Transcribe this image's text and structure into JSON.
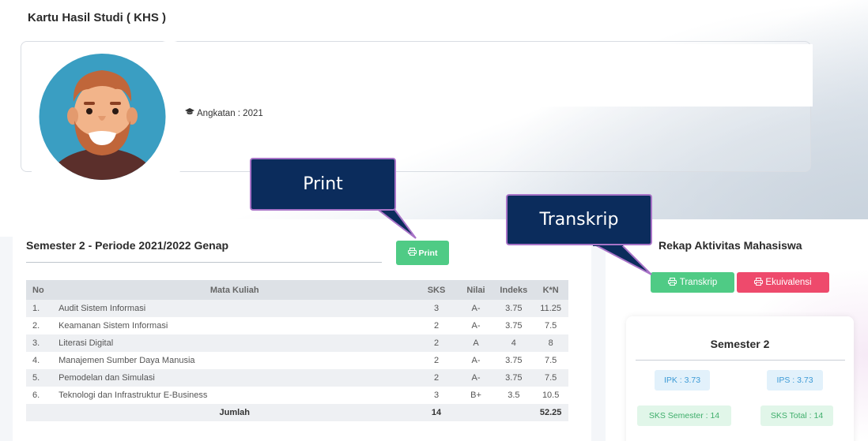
{
  "page": {
    "title": "Kartu Hasil Studi ( KHS )"
  },
  "profile": {
    "angkatan_label": "Angkatan : 2021"
  },
  "semester": {
    "title": "Semester 2 - Periode 2021/2022 Genap",
    "print_label": "Print"
  },
  "table": {
    "headers": {
      "no": "No",
      "mata_kuliah": "Mata Kuliah",
      "sks": "SKS",
      "nilai": "Nilai",
      "indeks": "Indeks",
      "kn": "K*N"
    },
    "rows": [
      {
        "no": "1.",
        "mk": "Audit Sistem Informasi",
        "sks": "3",
        "nilai": "A-",
        "indeks": "3.75",
        "kn": "11.25"
      },
      {
        "no": "2.",
        "mk": "Keamanan Sistem Informasi",
        "sks": "2",
        "nilai": "A-",
        "indeks": "3.75",
        "kn": "7.5"
      },
      {
        "no": "3.",
        "mk": "Literasi Digital",
        "sks": "2",
        "nilai": "A",
        "indeks": "4",
        "kn": "8"
      },
      {
        "no": "4.",
        "mk": "Manajemen Sumber Daya Manusia",
        "sks": "2",
        "nilai": "A-",
        "indeks": "3.75",
        "kn": "7.5"
      },
      {
        "no": "5.",
        "mk": "Pemodelan dan Simulasi",
        "sks": "2",
        "nilai": "A-",
        "indeks": "3.75",
        "kn": "7.5"
      },
      {
        "no": "6.",
        "mk": "Teknologi dan Infrastruktur E-Business",
        "sks": "3",
        "nilai": "B+",
        "indeks": "3.5",
        "kn": "10.5"
      }
    ],
    "total": {
      "label": "Jumlah",
      "sks": "14",
      "kn": "52.25"
    }
  },
  "rekap": {
    "title": "Rekap Aktivitas Mahasiswa",
    "transkrip_label": "Transkrip",
    "ekuivalensi_label": "Ekuivalensi",
    "semester_title": "Semester 2",
    "ipk": "IPK : 3.73",
    "ips": "IPS : 3.73",
    "sks_semester": "SKS Semester : 14",
    "sks_total": "SKS Total : 14"
  },
  "callouts": {
    "print": "Print",
    "transkrip": "Transkrip"
  },
  "colors": {
    "green": "#4fcb85",
    "red": "#ee4a6c",
    "callout_bg": "#0b2c5c",
    "callout_border": "#a873c7"
  },
  "icons": {
    "print": "printer-icon",
    "graduation": "graduation-cap-icon"
  }
}
